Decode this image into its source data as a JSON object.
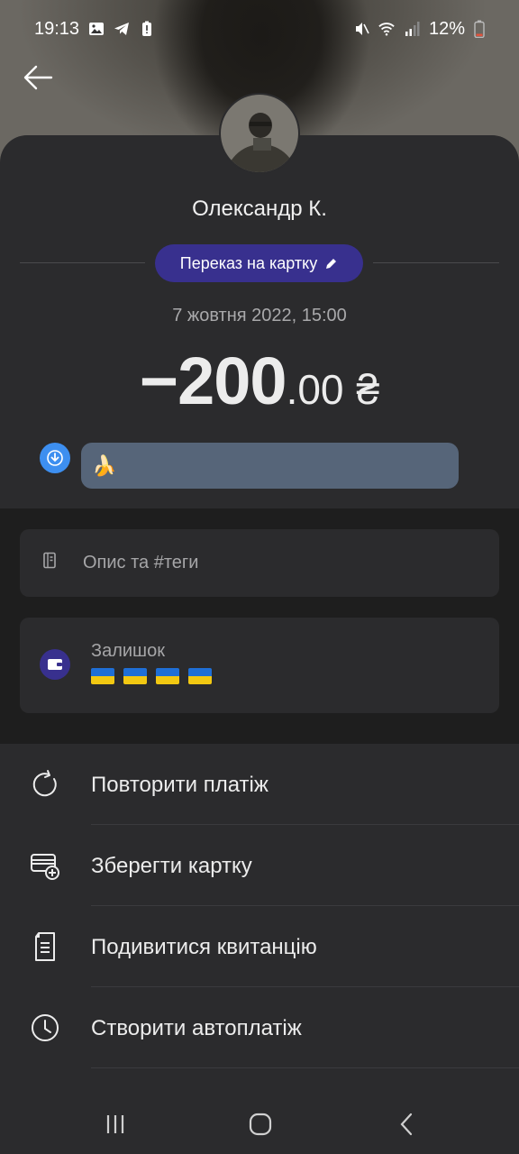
{
  "status_bar": {
    "time": "19:13",
    "battery": "12%"
  },
  "transaction": {
    "recipient_name": "Олександр К.",
    "type_label": "Переказ на картку",
    "datetime": "7 жовтня 2022, 15:00",
    "amount_integer": "−200",
    "amount_decimal": ".00",
    "currency": "₴",
    "message": "🍌"
  },
  "details": {
    "description_placeholder": "Опис та #теги",
    "balance_label": "Залишок"
  },
  "actions": [
    {
      "label": "Повторити платіж",
      "icon": "repeat-icon"
    },
    {
      "label": "Зберегти картку",
      "icon": "card-add-icon"
    },
    {
      "label": "Подивитися квитанцію",
      "icon": "receipt-icon"
    },
    {
      "label": "Створити автоплатіж",
      "icon": "clock-icon"
    }
  ],
  "colors": {
    "accent": "#38308e",
    "message_bubble": "#566579",
    "message_icon": "#3d8ff0",
    "background": "#1e1e1e",
    "card": "#2b2b2d"
  }
}
